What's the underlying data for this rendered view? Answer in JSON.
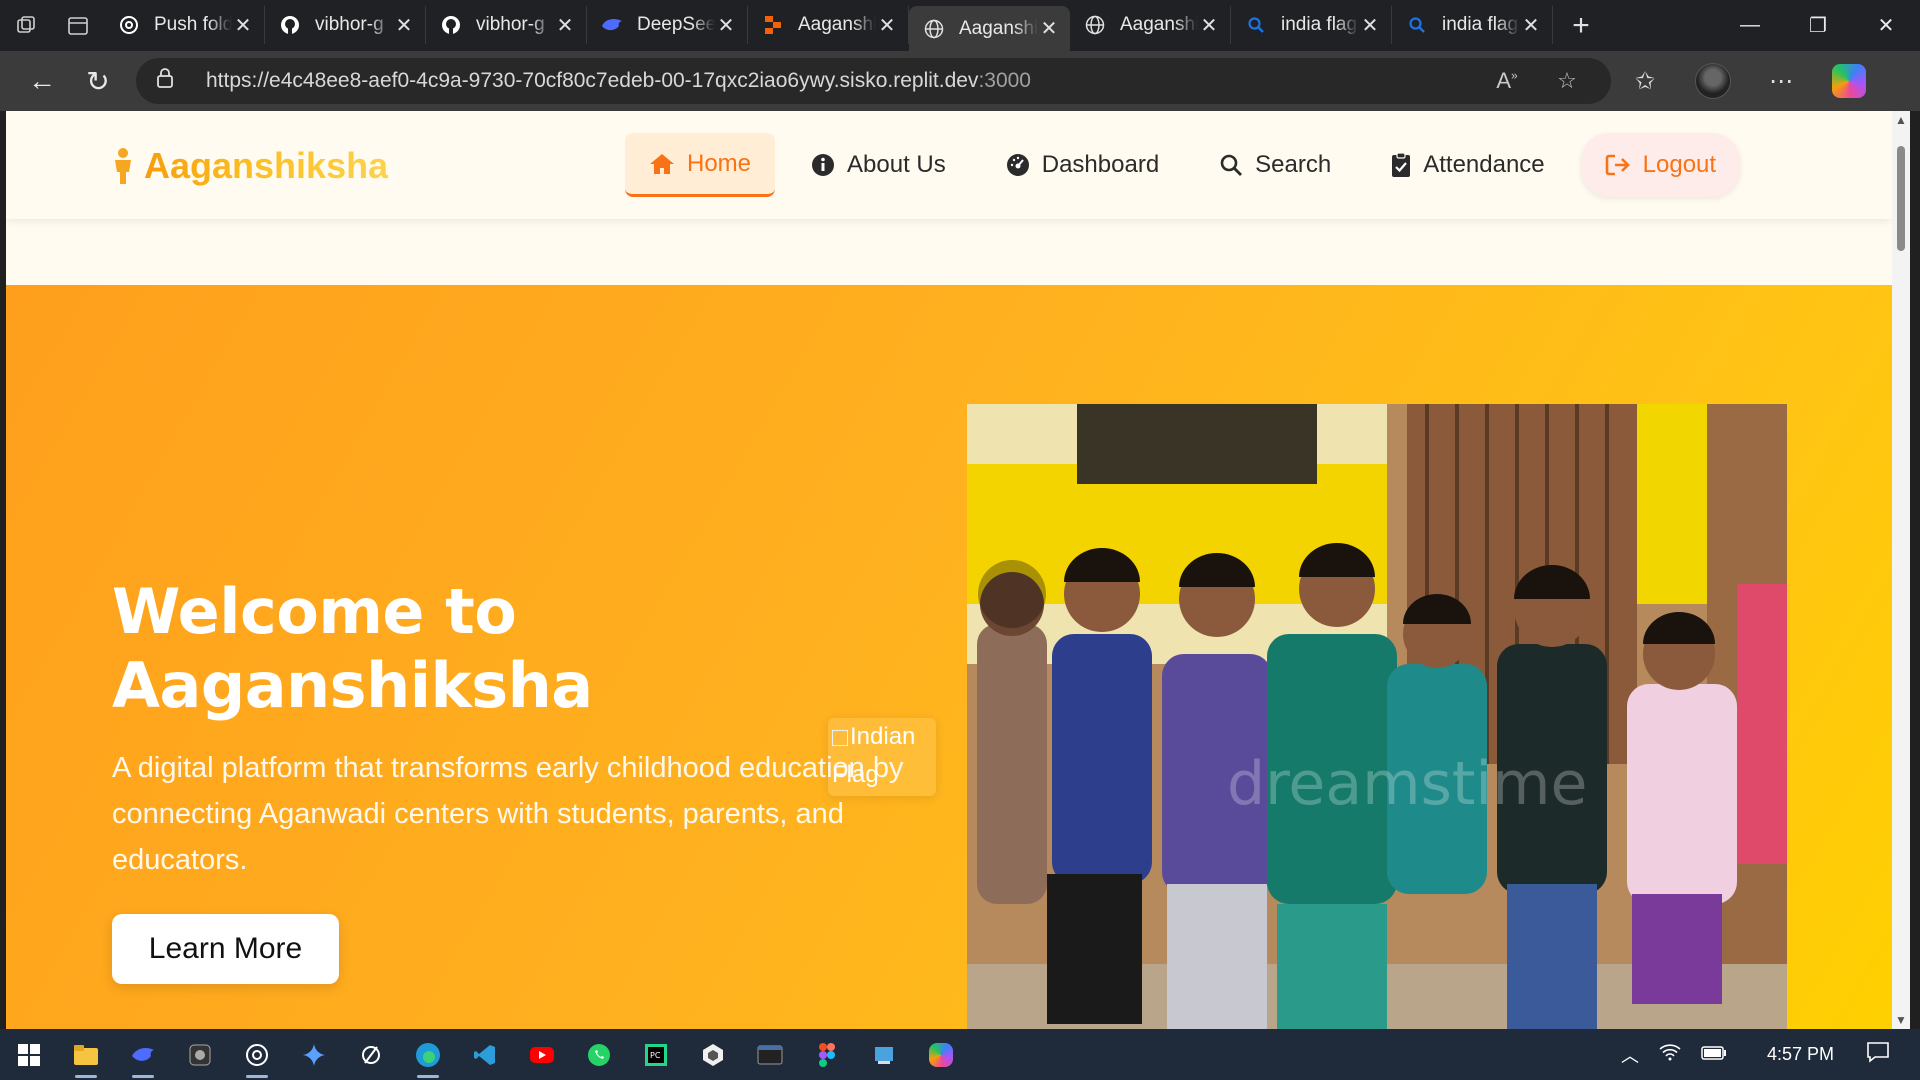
{
  "browser": {
    "tabs": [
      {
        "label": "Push folder",
        "icon": "openai-icon"
      },
      {
        "label": "vibhor-g",
        "icon": "github-icon"
      },
      {
        "label": "vibhor-g",
        "icon": "github-icon"
      },
      {
        "label": "DeepSeek",
        "icon": "deepseek-icon"
      },
      {
        "label": "Aaganshiksha",
        "icon": "replit-icon"
      },
      {
        "label": "Aaganshiksha",
        "icon": "globe-icon",
        "active": true
      },
      {
        "label": "Aaganshiksha",
        "icon": "globe-icon"
      },
      {
        "label": "india flag",
        "icon": "search-icon"
      },
      {
        "label": "india flag",
        "icon": "search-icon"
      }
    ],
    "url_main": "https://e4c48ee8-aef0-4c9a-9730-70cf80c7edeb-00-17qxc2iao6ywy.sisko.replit.dev",
    "url_port": ":3000"
  },
  "site": {
    "brand_part1": "Aagan",
    "brand_part2": "shiksha",
    "nav": {
      "home": "Home",
      "about": "About Us",
      "dashboard": "Dashboard",
      "search": "Search",
      "attendance": "Attendance",
      "logout": "Logout"
    },
    "hero": {
      "title": "Welcome to Aaganshiksha",
      "description": "A digital platform that transforms early childhood education by connecting Aganwadi centers with students, parents, and educators.",
      "button": "Learn More",
      "flag_alt": "Indian Flag"
    },
    "colors": {
      "accent": "#f97316",
      "hero_start": "#ff9f1c",
      "hero_end": "#ffd000",
      "nav_bg": "#fffbf0"
    }
  },
  "taskbar": {
    "time": "4:57 PM"
  }
}
